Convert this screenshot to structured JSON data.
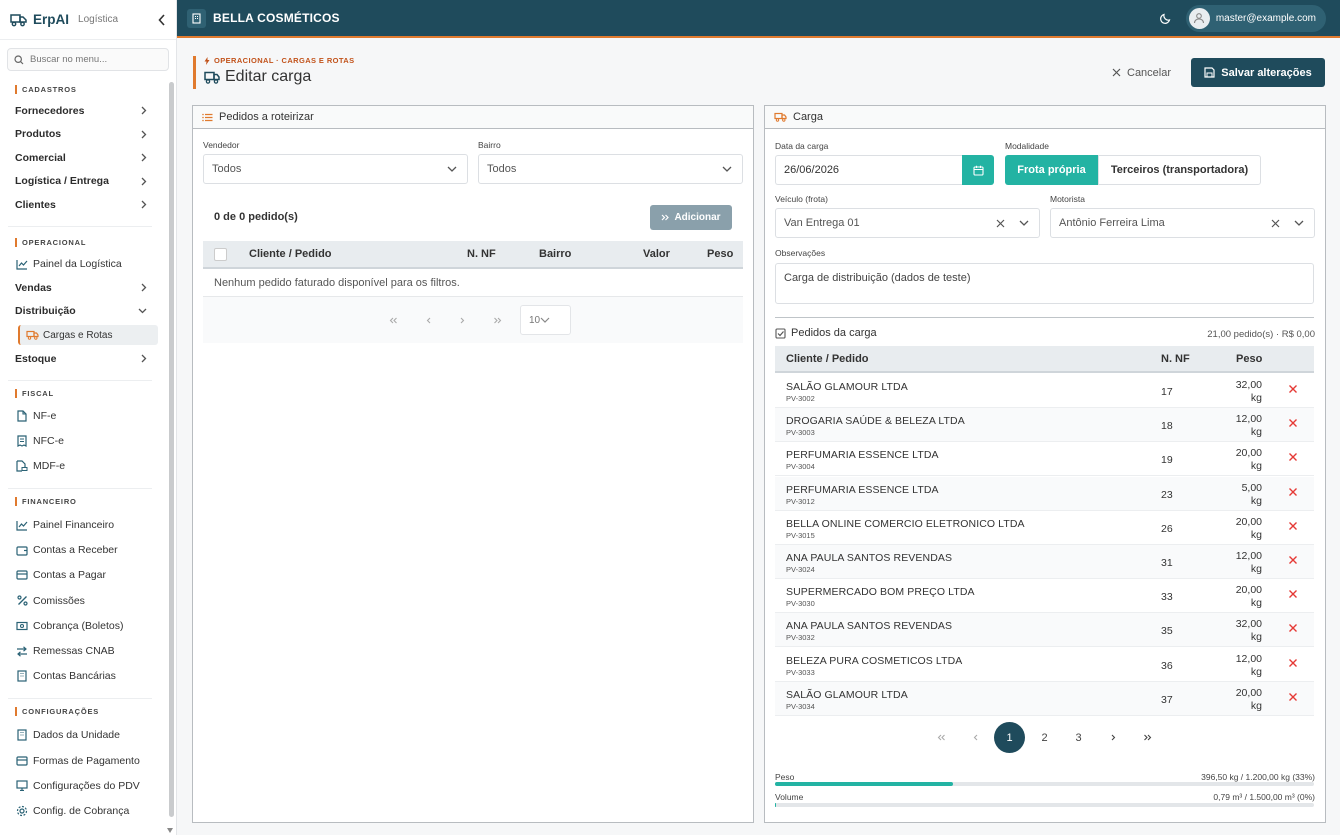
{
  "sidebar": {
    "brand": "ErpAI",
    "module": "Logística",
    "search_placeholder": "Buscar no menu...",
    "sections": {
      "cadastros": "CADASTROS",
      "operacional": "OPERACIONAL",
      "fiscal": "FISCAL",
      "financeiro": "FINANCEIRO",
      "configuracoes": "CONFIGURAÇÕES"
    },
    "items": {
      "fornecedores": "Fornecedores",
      "produtos": "Produtos",
      "comercial": "Comercial",
      "logistica": "Logística / Entrega",
      "clientes": "Clientes",
      "painel_logistica": "Painel da Logística",
      "vendas": "Vendas",
      "distribuicao": "Distribuição",
      "cargas_rotas": "Cargas e Rotas",
      "estoque": "Estoque",
      "nfe": "NF-e",
      "nfce": "NFC-e",
      "mdfe": "MDF-e",
      "painel_financeiro": "Painel Financeiro",
      "contas_receber": "Contas a Receber",
      "contas_pagar": "Contas a Pagar",
      "comissoes": "Comissões",
      "cobranca": "Cobrança (Boletos)",
      "remessas": "Remessas CNAB",
      "contas_bancarias": "Contas Bancárias",
      "dados_unidade": "Dados da Unidade",
      "formas_pagamento": "Formas de Pagamento",
      "config_pdv": "Configurações do PDV",
      "config_cobranca": "Config. de Cobrança"
    }
  },
  "topbar": {
    "company": "BELLA COSMÉTICOS",
    "user_email": "master@example.com"
  },
  "page": {
    "breadcrumb": "OPERACIONAL · CARGAS E ROTAS",
    "title": "Editar carga",
    "cancel_label": "Cancelar",
    "save_label": "Salvar alterações"
  },
  "left_panel": {
    "title": "Pedidos a roteirizar",
    "vendedor_label": "Vendedor",
    "vendedor_value": "Todos",
    "bairro_label": "Bairro",
    "bairro_value": "Todos",
    "count": "0 de 0 pedido(s)",
    "add_label": "Adicionar",
    "columns": {
      "cliente": "Cliente / Pedido",
      "nf": "N. NF",
      "bairro": "Bairro",
      "valor": "Valor",
      "peso": "Peso"
    },
    "empty_message": "Nenhum pedido faturado disponível para os filtros.",
    "page_size": "10"
  },
  "right_panel": {
    "title": "Carga",
    "data_label": "Data da carga",
    "data_value": "26/06/2026",
    "modalidade_label": "Modalidade",
    "mod_frota": "Frota própria",
    "mod_terceiros": "Terceiros (transportadora)",
    "veiculo_label": "Veículo (frota)",
    "veiculo_value": "Van Entrega 01",
    "motorista_label": "Motorista",
    "motorista_value": "Antônio Ferreira Lima",
    "obs_label": "Observações",
    "obs_value": "Carga de distribuição (dados de teste)",
    "pedidos_title": "Pedidos da carga",
    "pedidos_summary": "21,00 pedido(s) · R$ 0,00",
    "columns": {
      "cliente": "Cliente / Pedido",
      "nf": "N. NF",
      "peso": "Peso"
    },
    "rows": [
      {
        "name": "SALÃO GLAMOUR LTDA",
        "code": "PV-3002",
        "nf": "17",
        "peso": "32,00",
        "unit": "kg"
      },
      {
        "name": "DROGARIA SAÚDE & BELEZA LTDA",
        "code": "PV-3003",
        "nf": "18",
        "peso": "12,00",
        "unit": "kg"
      },
      {
        "name": "PERFUMARIA ESSENCE LTDA",
        "code": "PV-3004",
        "nf": "19",
        "peso": "20,00",
        "unit": "kg"
      },
      {
        "name": "PERFUMARIA ESSENCE LTDA",
        "code": "PV-3012",
        "nf": "23",
        "peso": "5,00",
        "unit": "kg"
      },
      {
        "name": "BELLA ONLINE COMERCIO ELETRONICO LTDA",
        "code": "PV-3015",
        "nf": "26",
        "peso": "20,00",
        "unit": "kg"
      },
      {
        "name": "ANA PAULA SANTOS REVENDAS",
        "code": "PV-3024",
        "nf": "31",
        "peso": "12,00",
        "unit": "kg"
      },
      {
        "name": "SUPERMERCADO BOM PREÇO LTDA",
        "code": "PV-3030",
        "nf": "33",
        "peso": "20,00",
        "unit": "kg"
      },
      {
        "name": "ANA PAULA SANTOS REVENDAS",
        "code": "PV-3032",
        "nf": "35",
        "peso": "32,00",
        "unit": "kg"
      },
      {
        "name": "BELEZA PURA COSMETICOS LTDA",
        "code": "PV-3033",
        "nf": "36",
        "peso": "12,00",
        "unit": "kg"
      },
      {
        "name": "SALÃO GLAMOUR LTDA",
        "code": "PV-3034",
        "nf": "37",
        "peso": "20,00",
        "unit": "kg"
      }
    ],
    "pages": [
      "1",
      "2",
      "3"
    ],
    "current_page": "1",
    "peso_label": "Peso",
    "peso_value": "396,50 kg / 1.200,00 kg (33%)",
    "peso_fraction": 0.33,
    "volume_label": "Volume",
    "volume_value": "0,79 m³ / 1.500,00 m³ (0%)",
    "volume_fraction": 0.0005
  },
  "colors": {
    "primary": "#1f4b5c",
    "accent": "#e07a2e",
    "teal": "#23b3a3",
    "danger": "#e53935"
  }
}
